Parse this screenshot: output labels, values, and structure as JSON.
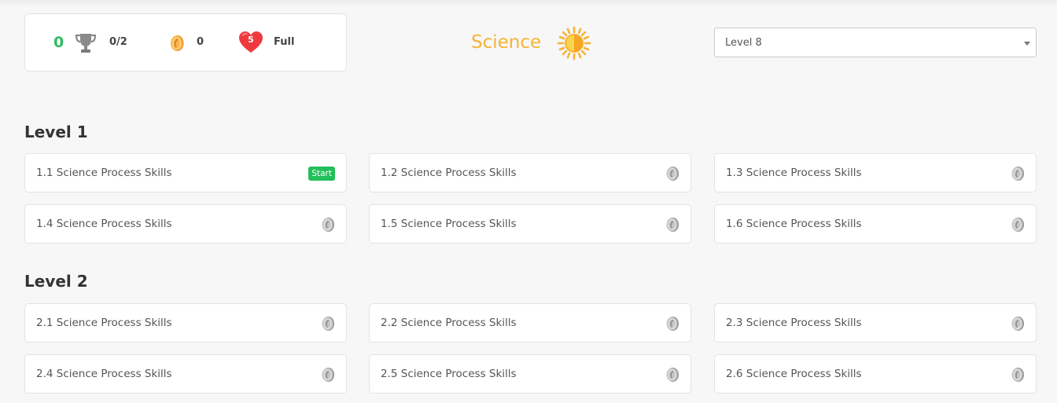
{
  "stats": {
    "points": "0",
    "trophies": "0/2",
    "coins": "0",
    "lives_count": "5",
    "lives_status": "Full"
  },
  "subject": {
    "title": "Science",
    "icon": "sun-icon",
    "accent_color": "#f7b234"
  },
  "level_select": {
    "selected": "Level 8"
  },
  "colors": {
    "points_green": "#2ebd5f",
    "start_badge": "#22c05a",
    "heart_red": "#ee3a3e"
  },
  "levels": [
    {
      "heading": "Level 1",
      "skills": [
        {
          "label": "1.1 Science Process Skills",
          "badge": "Start",
          "status": "start"
        },
        {
          "label": "1.2 Science Process Skills",
          "status": "locked-coin"
        },
        {
          "label": "1.3 Science Process Skills",
          "status": "locked-coin"
        },
        {
          "label": "1.4 Science Process Skills",
          "status": "locked-coin"
        },
        {
          "label": "1.5 Science Process Skills",
          "status": "locked-coin"
        },
        {
          "label": "1.6 Science Process Skills",
          "status": "locked-coin"
        }
      ]
    },
    {
      "heading": "Level 2",
      "skills": [
        {
          "label": "2.1 Science Process Skills",
          "status": "locked-coin"
        },
        {
          "label": "2.2 Science Process Skills",
          "status": "locked-coin"
        },
        {
          "label": "2.3 Science Process Skills",
          "status": "locked-coin"
        },
        {
          "label": "2.4 Science Process Skills",
          "status": "locked-coin"
        },
        {
          "label": "2.5 Science Process Skills",
          "status": "locked-coin"
        },
        {
          "label": "2.6 Science Process Skills",
          "status": "locked-coin"
        }
      ]
    }
  ]
}
